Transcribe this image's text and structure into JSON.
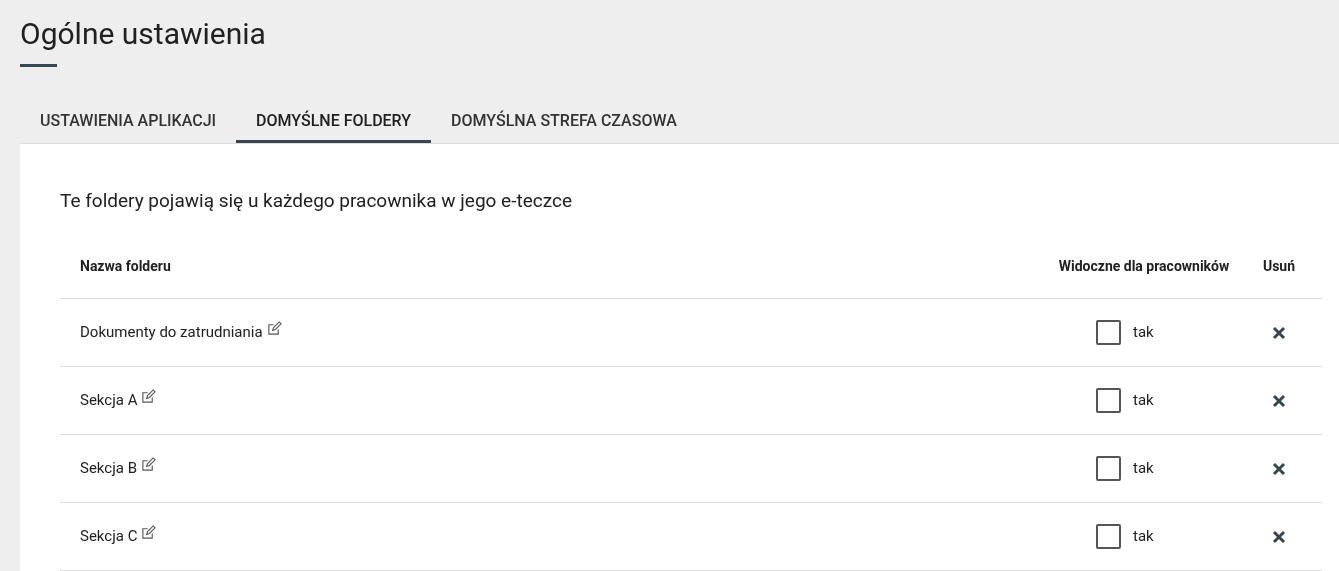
{
  "page_title": "Ogólne ustawienia",
  "tabs": [
    {
      "label": "USTAWIENIA APLIKACJI",
      "selected": false
    },
    {
      "label": "DOMYŚLNE FOLDERY",
      "selected": true
    },
    {
      "label": "DOMYŚLNA STREFA CZASOWA",
      "selected": false
    }
  ],
  "description": "Te foldery pojawią się u każdego pracownika w jego e-teczce",
  "table": {
    "columns": [
      "Nazwa folderu",
      "Widoczne dla pracowników",
      "Usuń"
    ],
    "rows": [
      {
        "name": "Dokumenty do zatrudniania",
        "visible_label": "tak",
        "checked": false
      },
      {
        "name": "Sekcja A",
        "visible_label": "tak",
        "checked": false
      },
      {
        "name": "Sekcja B",
        "visible_label": "tak",
        "checked": false
      },
      {
        "name": "Sekcja C",
        "visible_label": "tak",
        "checked": false
      }
    ]
  }
}
